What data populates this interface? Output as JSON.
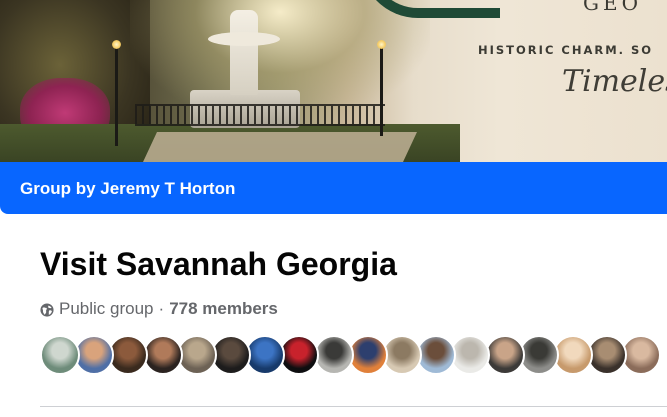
{
  "cover": {
    "brand_letters": "GEO",
    "tagline": "HISTORIC CHARM. SO",
    "script_text": "Timeles"
  },
  "banner": {
    "label": "Group by Jeremy T Horton",
    "color": "#0866ff"
  },
  "group": {
    "name": "Visit Savannah Georgia",
    "privacy_icon": "globe-icon",
    "privacy": "Public group",
    "separator": "·",
    "members": "778 members"
  },
  "member_avatars": [
    {
      "colors": [
        "#6e8c7a",
        "#cfd7cf"
      ]
    },
    {
      "colors": [
        "#4f6fa6",
        "#d9a37c"
      ]
    },
    {
      "colors": [
        "#3a2a1e",
        "#8c5a3c"
      ]
    },
    {
      "colors": [
        "#2b2320",
        "#b07a5a"
      ]
    },
    {
      "colors": [
        "#6d6255",
        "#b9a78c"
      ]
    },
    {
      "colors": [
        "#1d1c1c",
        "#5a4a3e"
      ]
    },
    {
      "colors": [
        "#173a6b",
        "#3c74c4"
      ]
    },
    {
      "colors": [
        "#0e0e10",
        "#c8222c"
      ]
    },
    {
      "colors": [
        "#b6b6b2",
        "#3a3a38"
      ]
    },
    {
      "colors": [
        "#e0803a",
        "#2d3f6e"
      ]
    },
    {
      "colors": [
        "#d7c9b3",
        "#8c7a62"
      ]
    },
    {
      "colors": [
        "#9fbad6",
        "#6b4e3b"
      ]
    },
    {
      "colors": [
        "#eaeae7",
        "#bcb7ae"
      ]
    },
    {
      "colors": [
        "#3c3a38",
        "#c9a488"
      ]
    },
    {
      "colors": [
        "#8d8d8a",
        "#3a3a36"
      ]
    },
    {
      "colors": [
        "#c79a6c",
        "#f1d9bd"
      ]
    },
    {
      "colors": [
        "#3a312b",
        "#a88d72"
      ]
    },
    {
      "colors": [
        "#8b6c5a",
        "#d9b9a0"
      ]
    }
  ]
}
